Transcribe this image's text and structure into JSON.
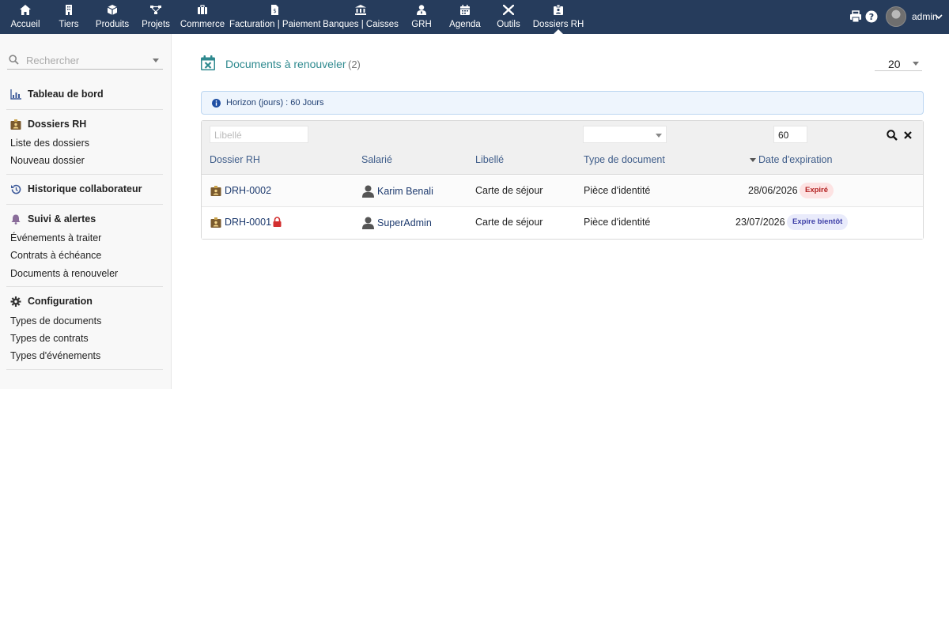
{
  "topnav": {
    "items": [
      {
        "label": "Accueil",
        "icon": "home-icon"
      },
      {
        "label": "Tiers",
        "icon": "building-icon"
      },
      {
        "label": "Produits",
        "icon": "cube-icon"
      },
      {
        "label": "Projets",
        "icon": "sitemap-icon"
      },
      {
        "label": "Commerce",
        "icon": "briefcase-icon"
      },
      {
        "label": "Facturation | Paiement",
        "icon": "invoice-icon"
      },
      {
        "label": "Banques | Caisses",
        "icon": "bank-icon"
      },
      {
        "label": "GRH",
        "icon": "user-tie-icon"
      },
      {
        "label": "Agenda",
        "icon": "calendar-icon"
      },
      {
        "label": "Outils",
        "icon": "tools-icon"
      },
      {
        "label": "Dossiers RH",
        "icon": "id-badge-icon",
        "active": true
      }
    ],
    "user": "admin",
    "bar_color": "#263c5c"
  },
  "sidebar": {
    "search_placeholder": "Rechercher",
    "sections": {
      "dashboard": "Tableau de bord",
      "dossiers": "Dossiers RH",
      "historique": "Historique collaborateur",
      "suivi": "Suivi & alertes",
      "config": "Configuration"
    },
    "links": {
      "liste_dossiers": "Liste des dossiers",
      "nouveau_dossier": "Nouveau dossier",
      "evenements": "Événements à traiter",
      "contrats": "Contrats à échéance",
      "documents": "Documents à renouveler",
      "types_documents": "Types de documents",
      "types_contrats": "Types de contrats",
      "types_evenements": "Types d'événements"
    }
  },
  "main": {
    "title": "Documents à renouveler",
    "count": "(2)",
    "page_size": "20",
    "info": "Horizon (jours) : 60 Jours",
    "filters": {
      "libelle_placeholder": "Libellé",
      "type_value": "",
      "horizon_value": "60"
    },
    "columns": [
      "Dossier RH",
      "Salarié",
      "Libellé",
      "Type de document",
      "Date d'expiration"
    ],
    "rows": [
      {
        "dossier": "DRH-0002",
        "salarie": "Karim Benali",
        "libelle": "Carte de séjour",
        "type": "Pièce d'identité",
        "date": "28/06/2026",
        "status": "Expiré",
        "locked": false
      },
      {
        "dossier": "DRH-0001",
        "salarie": "SuperAdmin",
        "libelle": "Carte de séjour",
        "type": "Pièce d'identité",
        "date": "23/07/2026",
        "status": "Expire bientôt",
        "locked": true
      }
    ],
    "accent_color": "#2f8a8f"
  }
}
